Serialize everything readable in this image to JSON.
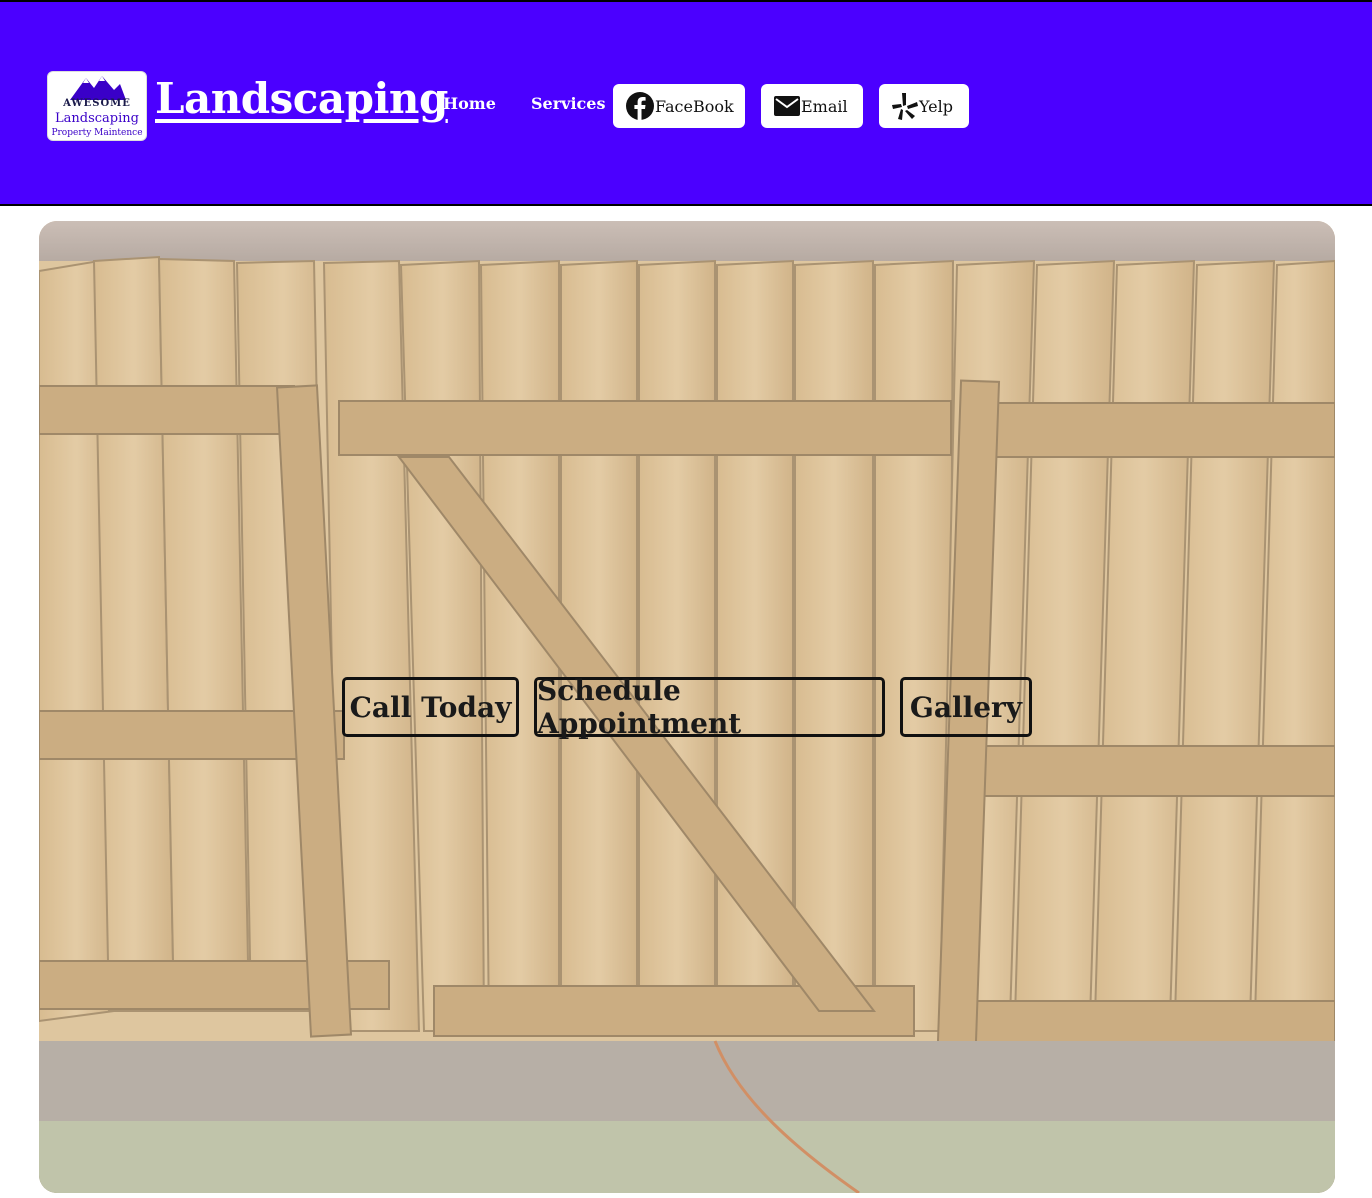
{
  "colors": {
    "header_bg": "#4b00ff",
    "logo_accent": "#3a00c8"
  },
  "logo": {
    "line1": "AWESOME",
    "line2": "Landscaping",
    "line3": "Property Maintence"
  },
  "header": {
    "title": "Landscaping"
  },
  "nav": {
    "home": "Home",
    "services": "Services"
  },
  "social": {
    "facebook": {
      "label": "FaceBook",
      "icon": "facebook-icon"
    },
    "email": {
      "label": "Email",
      "icon": "mail-icon"
    },
    "yelp": {
      "label": "Yelp",
      "icon": "yelp-icon"
    }
  },
  "hero": {
    "image": "wooden-fence-gate-photo",
    "buttons": {
      "call": "Call Today",
      "schedule": "Schedule Appointment",
      "gallery": "Gallery"
    }
  }
}
